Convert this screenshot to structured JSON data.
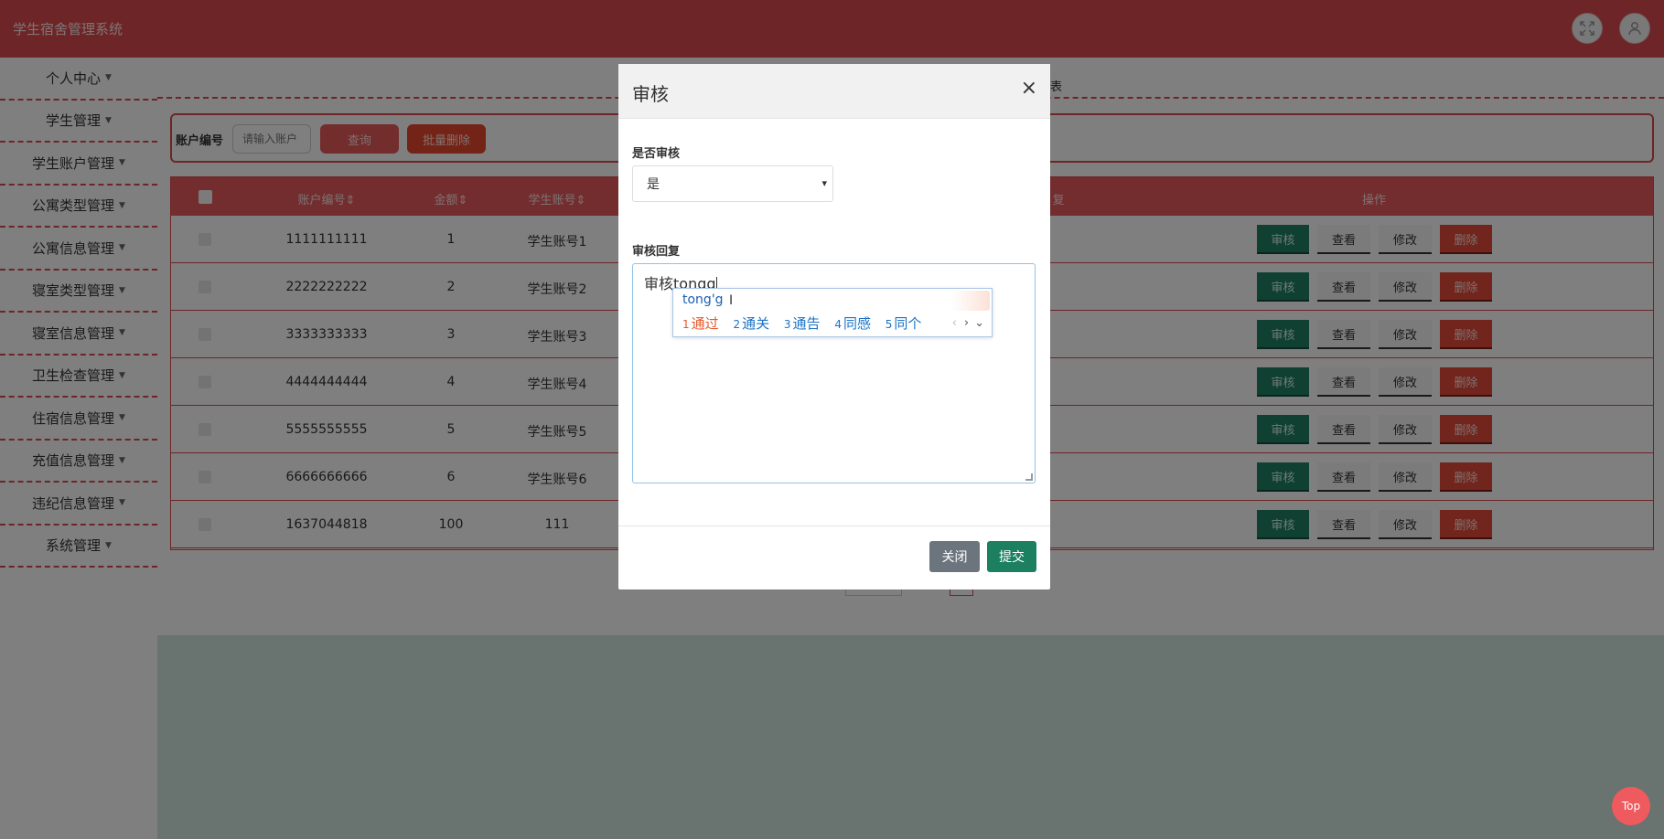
{
  "app": {
    "title": "学生宿舍管理系统"
  },
  "sidebar": {
    "items": [
      {
        "label": "个人中心"
      },
      {
        "label": "学生管理"
      },
      {
        "label": "学生账户管理"
      },
      {
        "label": "公寓类型管理"
      },
      {
        "label": "公寓信息管理"
      },
      {
        "label": "寝室类型管理"
      },
      {
        "label": "寝室信息管理"
      },
      {
        "label": "卫生检查管理"
      },
      {
        "label": "住宿信息管理"
      },
      {
        "label": "充值信息管理"
      },
      {
        "label": "违纪信息管理"
      },
      {
        "label": "系统管理"
      }
    ]
  },
  "breadcrumb": {
    "tail": "表"
  },
  "search": {
    "label": "账户编号",
    "placeholder": "请输入账户",
    "query_label": "查询",
    "batch_delete_label": "批量删除"
  },
  "table": {
    "headers": {
      "account_no": "账户编号",
      "amount": "金额",
      "student_account": "学生账号",
      "reply": "复",
      "actions": "操作"
    },
    "rows": [
      {
        "account_no": "1111111111",
        "amount": "1",
        "student_account": "学生账号1"
      },
      {
        "account_no": "2222222222",
        "amount": "2",
        "student_account": "学生账号2"
      },
      {
        "account_no": "3333333333",
        "amount": "3",
        "student_account": "学生账号3"
      },
      {
        "account_no": "4444444444",
        "amount": "4",
        "student_account": "学生账号4"
      },
      {
        "account_no": "5555555555",
        "amount": "5",
        "student_account": "学生账号5"
      },
      {
        "account_no": "6666666666",
        "amount": "6",
        "student_account": "学生账号6"
      },
      {
        "account_no": "1637044818",
        "amount": "100",
        "student_account": "111"
      }
    ],
    "actions": {
      "audit": "审核",
      "view": "查看",
      "edit": "修改",
      "delete": "删除"
    }
  },
  "modal": {
    "title": "审核",
    "close_symbol": "×",
    "audit_label": "是否审核",
    "audit_value": "是",
    "reply_label": "审核回复",
    "reply_text": "审核tongg",
    "close_button": "关闭",
    "submit_button": "提交"
  },
  "ime": {
    "pinyin": "tong'g",
    "candidates": [
      {
        "n": "1",
        "text": "通过"
      },
      {
        "n": "2",
        "text": "通关"
      },
      {
        "n": "3",
        "text": "通告"
      },
      {
        "n": "4",
        "text": "同感"
      },
      {
        "n": "5",
        "text": "同个"
      }
    ]
  },
  "top_button": {
    "label": "Top"
  }
}
